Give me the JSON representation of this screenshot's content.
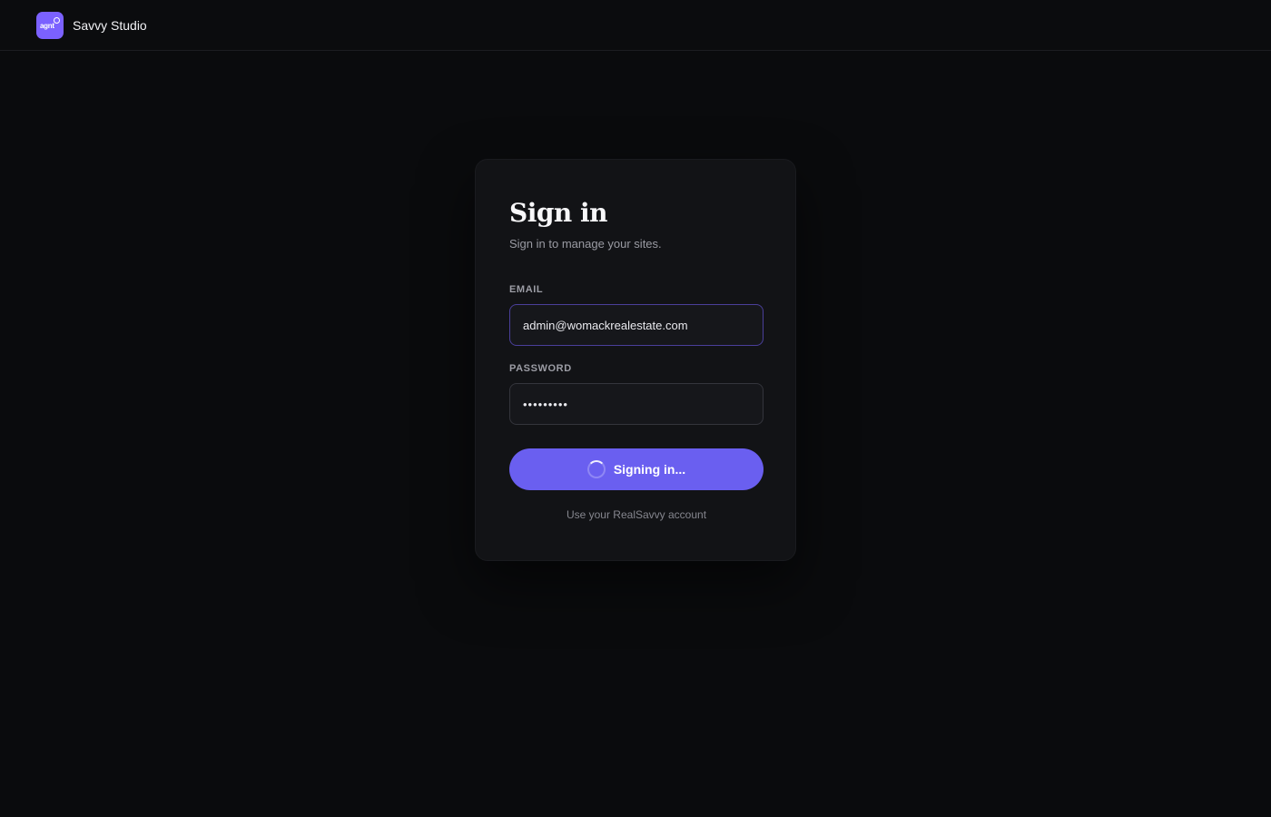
{
  "header": {
    "logo_text": "agnt",
    "brand_name": "Savvy Studio"
  },
  "signin": {
    "title": "Sign in",
    "subtitle": "Sign in to manage your sites.",
    "email_label": "EMAIL",
    "email_value": "admin@womackrealestate.com",
    "password_label": "PASSWORD",
    "password_value": "•••••••••",
    "submit_label": "Signing in...",
    "footer_note": "Use your RealSavvy account"
  },
  "colors": {
    "background": "#0a0b0d",
    "card": "#121316",
    "accent": "#6a5ff0",
    "logo": "#7b61ff"
  },
  "icons": {
    "logo": "agnt-logo-icon",
    "loading": "spinner-icon"
  }
}
